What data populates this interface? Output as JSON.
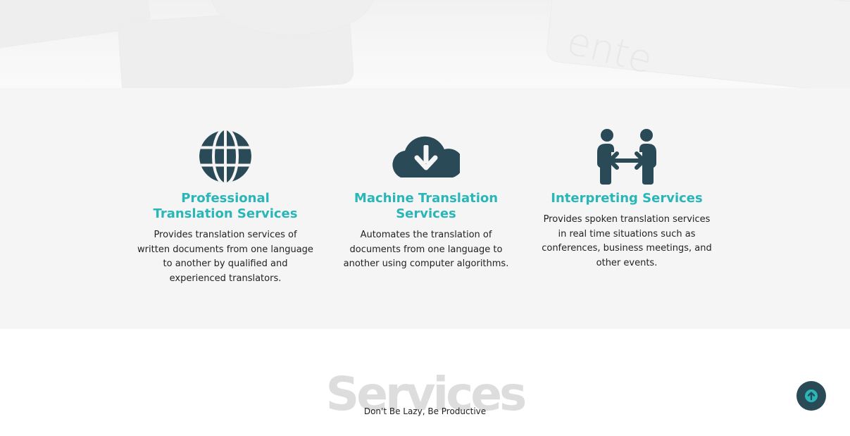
{
  "features": [
    {
      "icon": "globe-icon",
      "title_line1": "Professional",
      "title_line2": "Translation Services",
      "desc_lines": [
        "Provides translation services of",
        "written documents from one language",
        "to another by qualified and",
        "experienced translators."
      ]
    },
    {
      "icon": "cloud-download-icon",
      "title_line1": "Machine Translation",
      "title_line2": "Services",
      "desc_lines": [
        "Automates the translation of",
        "documents from one language to",
        "another using computer algorithms."
      ]
    },
    {
      "icon": "people-arrows-icon",
      "title_line1": "Interpreting Services",
      "desc_lines": [
        "Provides spoken translation services",
        "in real time situations such as",
        "conferences, business meetings, and",
        "other events."
      ]
    }
  ],
  "services_section": {
    "heading": "Services",
    "subheading": "Don't Be Lazy, Be Productive"
  },
  "back_to_top": {
    "icon": "arrow-up-circle-icon"
  },
  "colors": {
    "accent": "#29b6b8",
    "icon": "#2b4a58",
    "band": "#f5f5f5"
  }
}
